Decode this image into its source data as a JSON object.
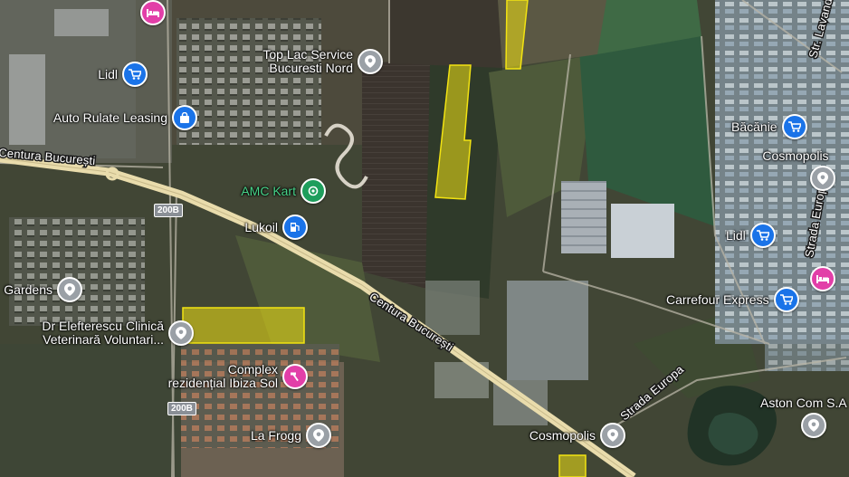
{
  "colors": {
    "primary_road": "#e9dcac",
    "highlight": "#f2e312",
    "marker_gray": "#9aa0a6",
    "marker_blue": "#1a73e8",
    "marker_pink": "#e23fa8",
    "marker_green": "#1e9e5c"
  },
  "roads": {
    "belt_west": "Centura București",
    "belt_main": "Centura București",
    "strada_europa_1": "Strada Europa",
    "strada_europa_2": "Strada Europa",
    "str_lavandei": "Str. Lavandei"
  },
  "shields": [
    "200B",
    "200B"
  ],
  "pois": {
    "top_lac": {
      "lines": [
        "Top Lac Service",
        "Bucuresti Nord"
      ],
      "icon": "pin-icon"
    },
    "lidl_west": {
      "lines": [
        "Lidl"
      ],
      "icon": "shopping-cart-icon"
    },
    "auto_rulate": {
      "lines": [
        "Auto Rulate Leasing"
      ],
      "icon": "shopping-bag-icon"
    },
    "amc_kart": {
      "lines": [
        "AMC Kart"
      ],
      "icon": "amusement-icon"
    },
    "lukoil": {
      "lines": [
        "Lukoil"
      ],
      "icon": "gas-station-icon"
    },
    "gardens": {
      "lines": [
        "Gardens"
      ],
      "icon": "pin-icon"
    },
    "dr_elefterescu": {
      "lines": [
        "Dr Elefterescu Clinică",
        "Veterinară Voluntari..."
      ],
      "icon": "pin-icon"
    },
    "complex_ibiza": {
      "lines": [
        "Complex",
        "rezidențial Ibiza Sol"
      ],
      "icon": "hammer-icon"
    },
    "la_frogg": {
      "lines": [
        "La Frogg"
      ],
      "icon": "pin-icon"
    },
    "cosmopolis_south": {
      "lines": [
        "Cosmopolis"
      ],
      "icon": "pin-icon"
    },
    "aston_com": {
      "lines": [
        "Aston Com S.A"
      ],
      "icon": "pin-icon"
    },
    "bacanie": {
      "lines": [
        "Băcănie"
      ],
      "icon": "shopping-cart-icon"
    },
    "cosmopolis_east": {
      "lines": [
        "Cosmopolis"
      ],
      "icon": "pin-icon"
    },
    "lidl_east": {
      "lines": [
        "Lidl"
      ],
      "icon": "shopping-cart-icon"
    },
    "carrefour": {
      "lines": [
        "Carrefour Express"
      ],
      "icon": "shopping-cart-icon"
    }
  }
}
